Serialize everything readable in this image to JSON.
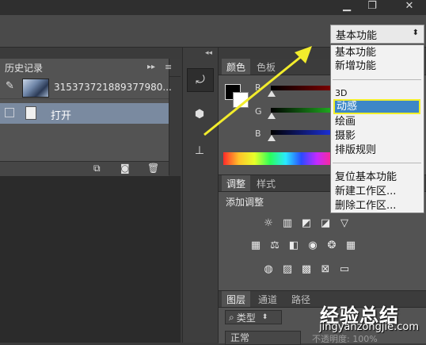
{
  "workspace": {
    "selected": "基本功能",
    "menu_items": [
      "基本功能",
      "新增功能",
      "3D",
      "动感",
      "绘画",
      "摄影",
      "排版规则",
      "复位基本功能",
      "新建工作区...",
      "删除工作区..."
    ],
    "highlighted_item": "动感"
  },
  "history": {
    "tab_label": "历史记录",
    "snapshot_name": "315373721889377980...",
    "step_label": "打开"
  },
  "color_panel": {
    "tabs": [
      "颜色",
      "色板"
    ],
    "channels": [
      "R",
      "G",
      "B"
    ]
  },
  "adjustments": {
    "tabs": [
      "调整",
      "样式"
    ],
    "add_label": "添加调整"
  },
  "layers": {
    "tabs": [
      "图层",
      "通道",
      "路径"
    ],
    "filter_label": "类型",
    "blend_mode": "正常",
    "opacity_label": "不透明度:",
    "opacity_value": "100%"
  },
  "watermark": {
    "title": "经验总结",
    "url": "jingyanzongjie.com"
  },
  "colors": {
    "accent_arrow": "#f2ec2c",
    "menu_highlight": "#3d87c7",
    "history_selected_row": "#7a8aa0"
  }
}
